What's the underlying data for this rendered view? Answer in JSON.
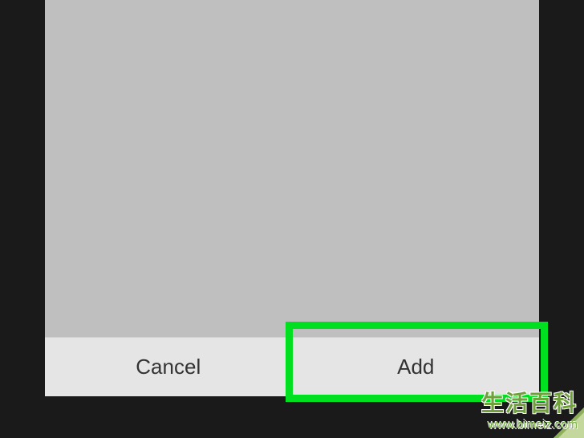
{
  "dialog": {
    "cancel_label": "Cancel",
    "add_label": "Add"
  },
  "watermark": {
    "text": "生活百科",
    "url": "www.bimeiz.com"
  },
  "highlight": {
    "color": "#00e020"
  }
}
